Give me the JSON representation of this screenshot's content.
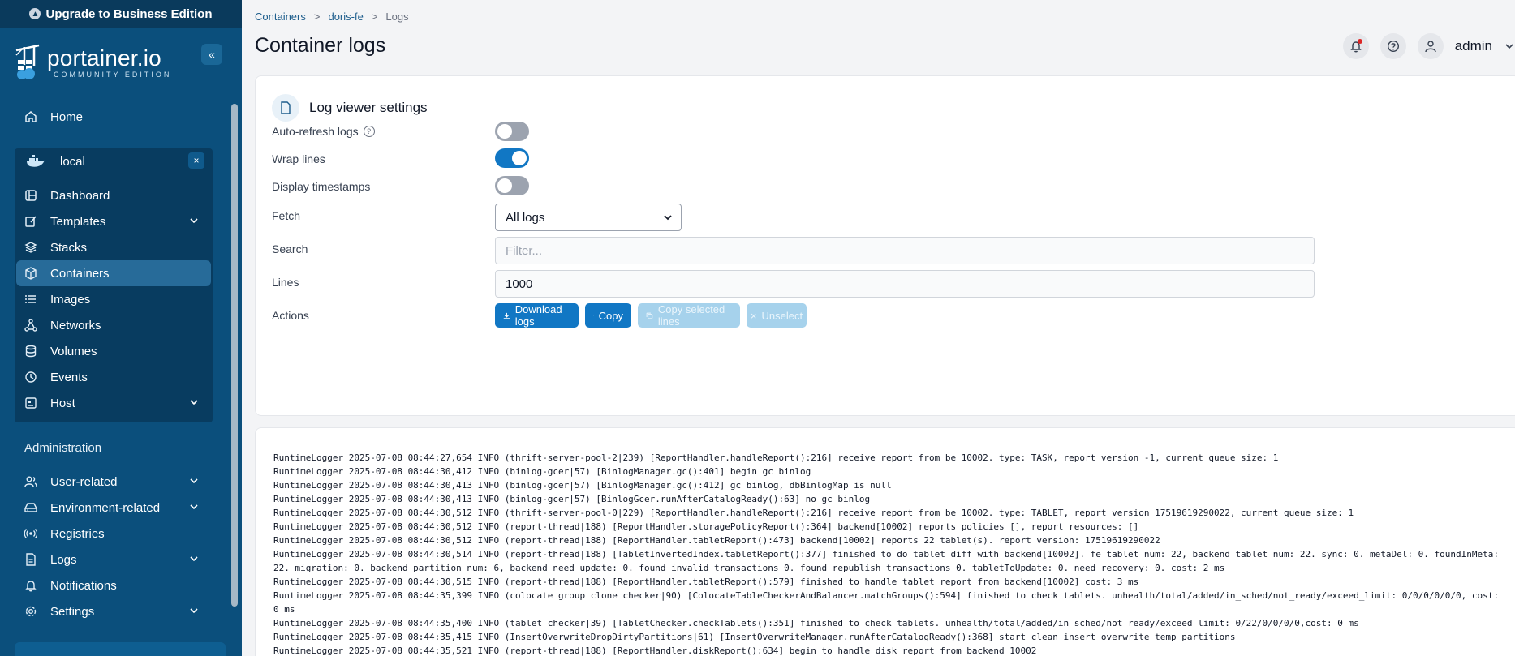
{
  "sidebar": {
    "upgrade_label": "Upgrade to Business Edition",
    "logo_text": "portainer.io",
    "logo_sub": "COMMUNITY EDITION",
    "home_label": "Home",
    "environment_name": "local",
    "env_items": [
      {
        "label": "Dashboard"
      },
      {
        "label": "Templates"
      },
      {
        "label": "Stacks"
      },
      {
        "label": "Containers"
      },
      {
        "label": "Images"
      },
      {
        "label": "Networks"
      },
      {
        "label": "Volumes"
      },
      {
        "label": "Events"
      },
      {
        "label": "Host"
      }
    ],
    "admin_title": "Administration",
    "admin_items": [
      {
        "label": "User-related"
      },
      {
        "label": "Environment-related"
      },
      {
        "label": "Registries"
      },
      {
        "label": "Logs"
      },
      {
        "label": "Notifications"
      },
      {
        "label": "Settings"
      }
    ]
  },
  "breadcrumb": {
    "items": [
      "Containers",
      "doris-fe",
      "Logs"
    ],
    "separator": ">"
  },
  "header": {
    "title": "Container logs",
    "user": "admin"
  },
  "settings": {
    "title": "Log viewer settings",
    "auto_refresh_label": "Auto-refresh logs",
    "wrap_lines_label": "Wrap lines",
    "timestamps_label": "Display timestamps",
    "fetch_label": "Fetch",
    "fetch_value": "All logs",
    "search_label": "Search",
    "search_placeholder": "Filter...",
    "lines_label": "Lines",
    "lines_value": "1000",
    "actions_label": "Actions",
    "download_label": "Download logs",
    "copy_label": "Copy",
    "copy_selected_label": "Copy selected lines",
    "unselect_label": "Unselect"
  },
  "toggles": {
    "auto_refresh": false,
    "wrap_lines": true,
    "display_timestamps": false
  },
  "logs": [
    "RuntimeLogger 2025-07-08 08:44:27,654 INFO (thrift-server-pool-2|239) [ReportHandler.handleReport():216] receive report from be 10002. type: TASK, report version -1, current queue size: 1",
    "RuntimeLogger 2025-07-08 08:44:30,412 INFO (binlog-gcer|57) [BinlogManager.gc():401] begin gc binlog",
    "RuntimeLogger 2025-07-08 08:44:30,413 INFO (binlog-gcer|57) [BinlogManager.gc():412] gc binlog, dbBinlogMap is null",
    "RuntimeLogger 2025-07-08 08:44:30,413 INFO (binlog-gcer|57) [BinlogGcer.runAfterCatalogReady():63] no gc binlog",
    "RuntimeLogger 2025-07-08 08:44:30,512 INFO (thrift-server-pool-0|229) [ReportHandler.handleReport():216] receive report from be 10002. type: TABLET, report version 17519619290022, current queue size: 1",
    "RuntimeLogger 2025-07-08 08:44:30,512 INFO (report-thread|188) [ReportHandler.storagePolicyReport():364] backend[10002] reports policies [], report resources: []",
    "RuntimeLogger 2025-07-08 08:44:30,512 INFO (report-thread|188) [ReportHandler.tabletReport():473] backend[10002] reports 22 tablet(s). report version: 17519619290022",
    "RuntimeLogger 2025-07-08 08:44:30,514 INFO (report-thread|188) [TabletInvertedIndex.tabletReport():377] finished to do tablet diff with backend[10002]. fe tablet num: 22, backend tablet num: 22. sync: 0. metaDel: 0. foundInMeta: 22. migration: 0. backend partition num: 6, backend need update: 0. found invalid transactions 0. found republish transactions 0. tabletToUpdate: 0. need recovery: 0. cost: 2 ms",
    "RuntimeLogger 2025-07-08 08:44:30,515 INFO (report-thread|188) [ReportHandler.tabletReport():579] finished to handle tablet report from backend[10002] cost: 3 ms",
    "RuntimeLogger 2025-07-08 08:44:35,399 INFO (colocate group clone checker|90) [ColocateTableCheckerAndBalancer.matchGroups():594] finished to check tablets. unhealth/total/added/in_sched/not_ready/exceed_limit: 0/0/0/0/0/0, cost: 0 ms",
    "RuntimeLogger 2025-07-08 08:44:35,400 INFO (tablet checker|39) [TabletChecker.checkTablets():351] finished to check tablets. unhealth/total/added/in_sched/not_ready/exceed_limit: 0/22/0/0/0/0,cost: 0 ms",
    "RuntimeLogger 2025-07-08 08:44:35,415 INFO (InsertOverwriteDropDirtyPartitions|61) [InsertOverwriteManager.runAfterCatalogReady():368] start clean insert overwrite temp partitions",
    "RuntimeLogger 2025-07-08 08:44:35,521 INFO (report-thread|188) [ReportHandler.diskReport():634] begin to handle disk report from backend 10002"
  ]
}
